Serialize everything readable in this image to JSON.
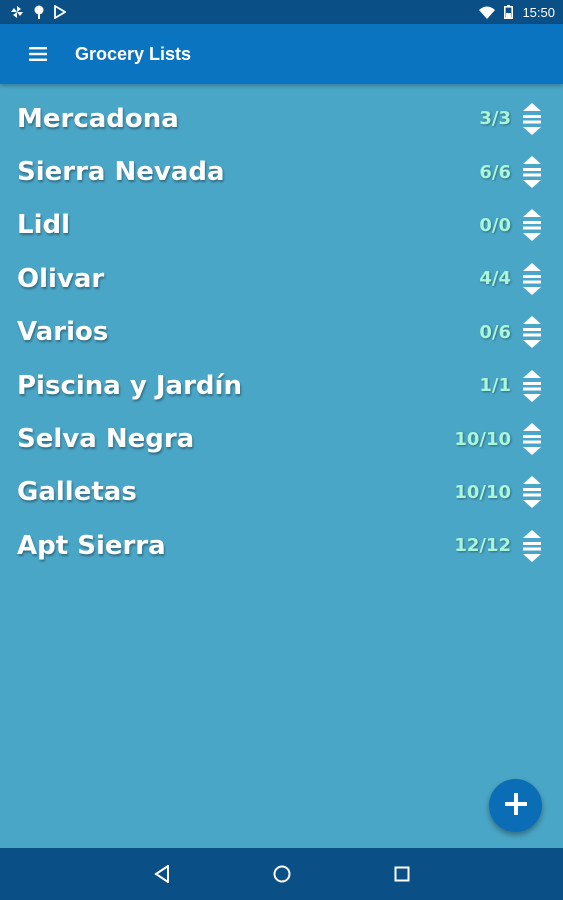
{
  "status_bar": {
    "time": "15:50",
    "left_icons": [
      "pinwheel-icon",
      "location-pin-icon",
      "play-store-icon"
    ],
    "right_icons": [
      "wifi-icon",
      "battery-icon"
    ]
  },
  "app_bar": {
    "title": "Grocery Lists",
    "menu_icon": "hamburger-menu-icon"
  },
  "lists": [
    {
      "name": "Mercadona",
      "count": "3/3"
    },
    {
      "name": "Sierra Nevada",
      "count": "6/6"
    },
    {
      "name": "Lidl",
      "count": "0/0"
    },
    {
      "name": "Olivar",
      "count": "4/4"
    },
    {
      "name": "Varios",
      "count": "0/6"
    },
    {
      "name": "Piscina y Jardín",
      "count": "1/1"
    },
    {
      "name": "Selva Negra",
      "count": "10/10"
    },
    {
      "name": "Galletas",
      "count": "10/10"
    },
    {
      "name": "Apt Sierra",
      "count": "12/12"
    }
  ],
  "fab": {
    "icon": "plus-icon"
  },
  "nav_bar": {
    "icons": [
      "back-icon",
      "home-icon",
      "recents-icon"
    ]
  },
  "colors": {
    "background": "#4aa6c7",
    "app_bar": "#0b74c1",
    "status_bar": "#0a4f86",
    "count_text": "#a9f6d8"
  }
}
